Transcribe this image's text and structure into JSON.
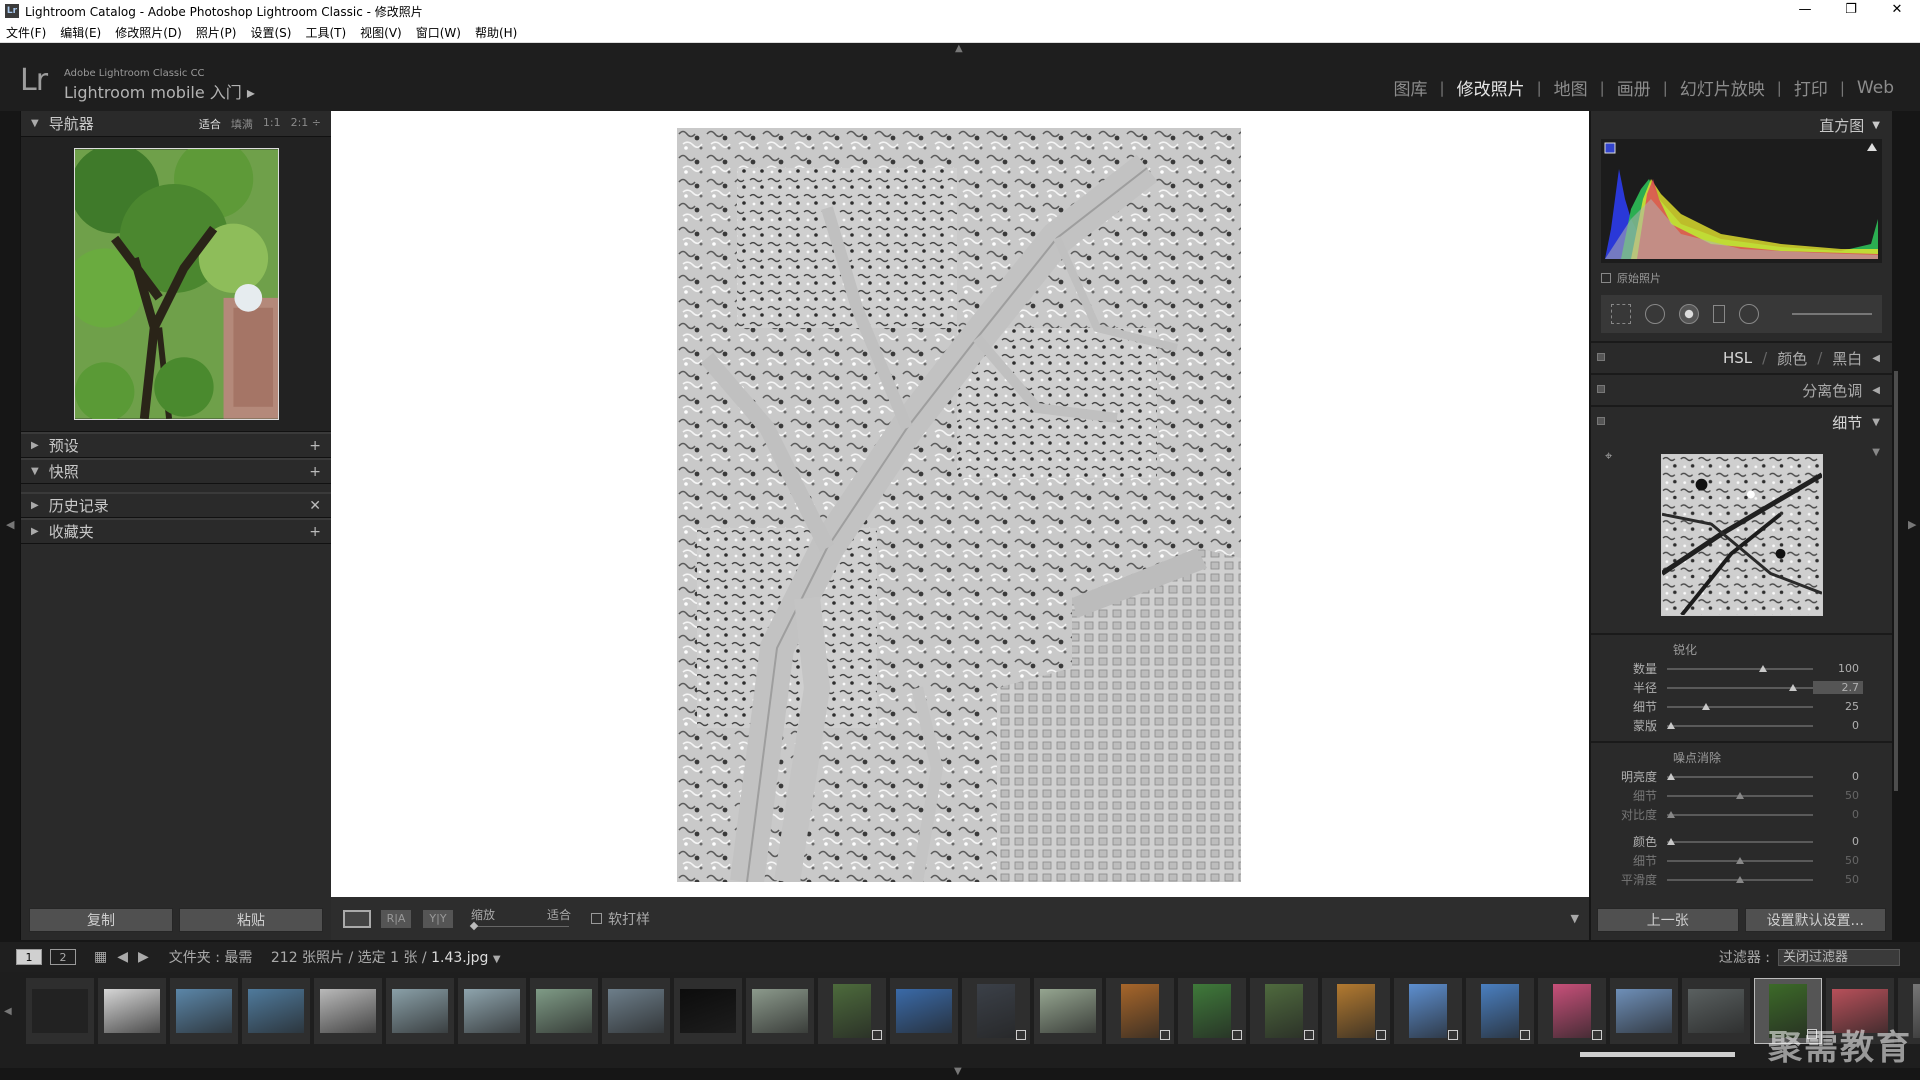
{
  "window": {
    "title": "Lightroom Catalog - Adobe Photoshop Lightroom Classic - 修改照片",
    "controls": {
      "minimize": "—",
      "maximize": "❐",
      "close": "✕"
    }
  },
  "menu": [
    "文件(F)",
    "编辑(E)",
    "修改照片(D)",
    "照片(P)",
    "设置(S)",
    "工具(T)",
    "视图(V)",
    "窗口(W)",
    "帮助(H)"
  ],
  "header": {
    "logo": "Lr",
    "brand_small": "Adobe Lightroom Classic CC",
    "brand_big": "Lightroom mobile 入门 ▸"
  },
  "modules": [
    {
      "label": "图库",
      "active": false
    },
    {
      "label": "修改照片",
      "active": true
    },
    {
      "label": "地图",
      "active": false
    },
    {
      "label": "画册",
      "active": false
    },
    {
      "label": "幻灯片放映",
      "active": false
    },
    {
      "label": "打印",
      "active": false
    },
    {
      "label": "Web",
      "active": false
    }
  ],
  "left": {
    "navigator": {
      "title": "导航器",
      "zooms": [
        "适合",
        "填满",
        "1:1",
        "2:1 ÷"
      ],
      "active_zoom": "适合"
    },
    "sections": [
      {
        "title": "预设",
        "action": "+"
      },
      {
        "title": "快照",
        "action": "+"
      },
      {
        "title": "历史记录",
        "action": "✕"
      },
      {
        "title": "收藏夹",
        "action": "+"
      }
    ],
    "buttons": {
      "copy": "复制",
      "paste": "粘贴"
    }
  },
  "toolbar": {
    "ra": "R|A",
    "yy": "Y|Y",
    "zoom_label": "缩放",
    "zoom_value": "适合",
    "soft_proof": "软打样"
  },
  "right": {
    "histogram_title": "直方图",
    "original_photo": "原始照片",
    "sections": {
      "hsl": "HSL",
      "color": "颜色",
      "bw": "黑白",
      "split_toning": "分离色调",
      "detail": "细节"
    },
    "sharpening": {
      "title": "锐化",
      "sliders": [
        {
          "label": "数量",
          "value": "100",
          "pos": 0.66,
          "dim": false,
          "hl": false
        },
        {
          "label": "半径",
          "value": "2.7",
          "pos": 0.86,
          "dim": false,
          "hl": true
        },
        {
          "label": "细节",
          "value": "25",
          "pos": 0.27,
          "dim": false,
          "hl": false
        },
        {
          "label": "蒙版",
          "value": "0",
          "pos": 0.03,
          "dim": false,
          "hl": false
        }
      ]
    },
    "noise": {
      "title": "噪点消除",
      "sliders": [
        {
          "label": "明亮度",
          "value": "0",
          "pos": 0.03,
          "dim": false
        },
        {
          "label": "细节",
          "value": "50",
          "pos": 0.5,
          "dim": true
        },
        {
          "label": "对比度",
          "value": "0",
          "pos": 0.03,
          "dim": true
        }
      ],
      "color_sliders": [
        {
          "label": "颜色",
          "value": "0",
          "pos": 0.03,
          "dim": false
        },
        {
          "label": "细节",
          "value": "50",
          "pos": 0.5,
          "dim": true
        },
        {
          "label": "平滑度",
          "value": "50",
          "pos": 0.5,
          "dim": true
        }
      ]
    },
    "buttons": {
      "prev": "上一张",
      "reset": "设置默认设置..."
    }
  },
  "filmbar": {
    "pages": [
      "1",
      "2"
    ],
    "folder_label": "文件夹 : 最需",
    "count": "212 张照片 / 选定 1 张 /",
    "filename": "1.43.jpg",
    "filter_label": "过滤器 :",
    "filter_value": "关闭过滤器"
  },
  "filmstrip": {
    "thumbs": [
      {
        "color": "#222222",
        "portrait": false
      },
      {
        "color": "#d6d6d6",
        "portrait": false
      },
      {
        "color": "#5b86a8",
        "portrait": false
      },
      {
        "color": "#4f7a9c",
        "portrait": false
      },
      {
        "color": "#b9b9b9",
        "portrait": false
      },
      {
        "color": "#8aa0a8",
        "portrait": false
      },
      {
        "color": "#8ea4ad",
        "portrait": false
      },
      {
        "color": "#7f9b86",
        "portrait": false
      },
      {
        "color": "#6d7e8a",
        "portrait": false
      },
      {
        "color": "#0c0c0c",
        "portrait": false
      },
      {
        "color": "#8c9a8c",
        "portrait": false
      },
      {
        "color": "#4d6b3c",
        "portrait": true
      },
      {
        "color": "#3a6aa8",
        "portrait": false
      },
      {
        "color": "#3b4048",
        "portrait": true
      },
      {
        "color": "#95a590",
        "portrait": false
      },
      {
        "color": "#a7662a",
        "portrait": true
      },
      {
        "color": "#3f7a3a",
        "portrait": true
      },
      {
        "color": "#4f6a3e",
        "portrait": true
      },
      {
        "color": "#b37a30",
        "portrait": true
      },
      {
        "color": "#5d8fd0",
        "portrait": true
      },
      {
        "color": "#4a7fc0",
        "portrait": true
      },
      {
        "color": "#c8507a",
        "portrait": true
      },
      {
        "color": "#6e8fb8",
        "portrait": false
      },
      {
        "color": "#5a6060",
        "portrait": false
      },
      {
        "color": "#3c6a28",
        "portrait": true
      },
      {
        "color": "#b8505a",
        "portrait": false
      },
      {
        "color": "#777777",
        "portrait": true
      }
    ],
    "selected_index": 24
  },
  "watermark": "聚需教育"
}
